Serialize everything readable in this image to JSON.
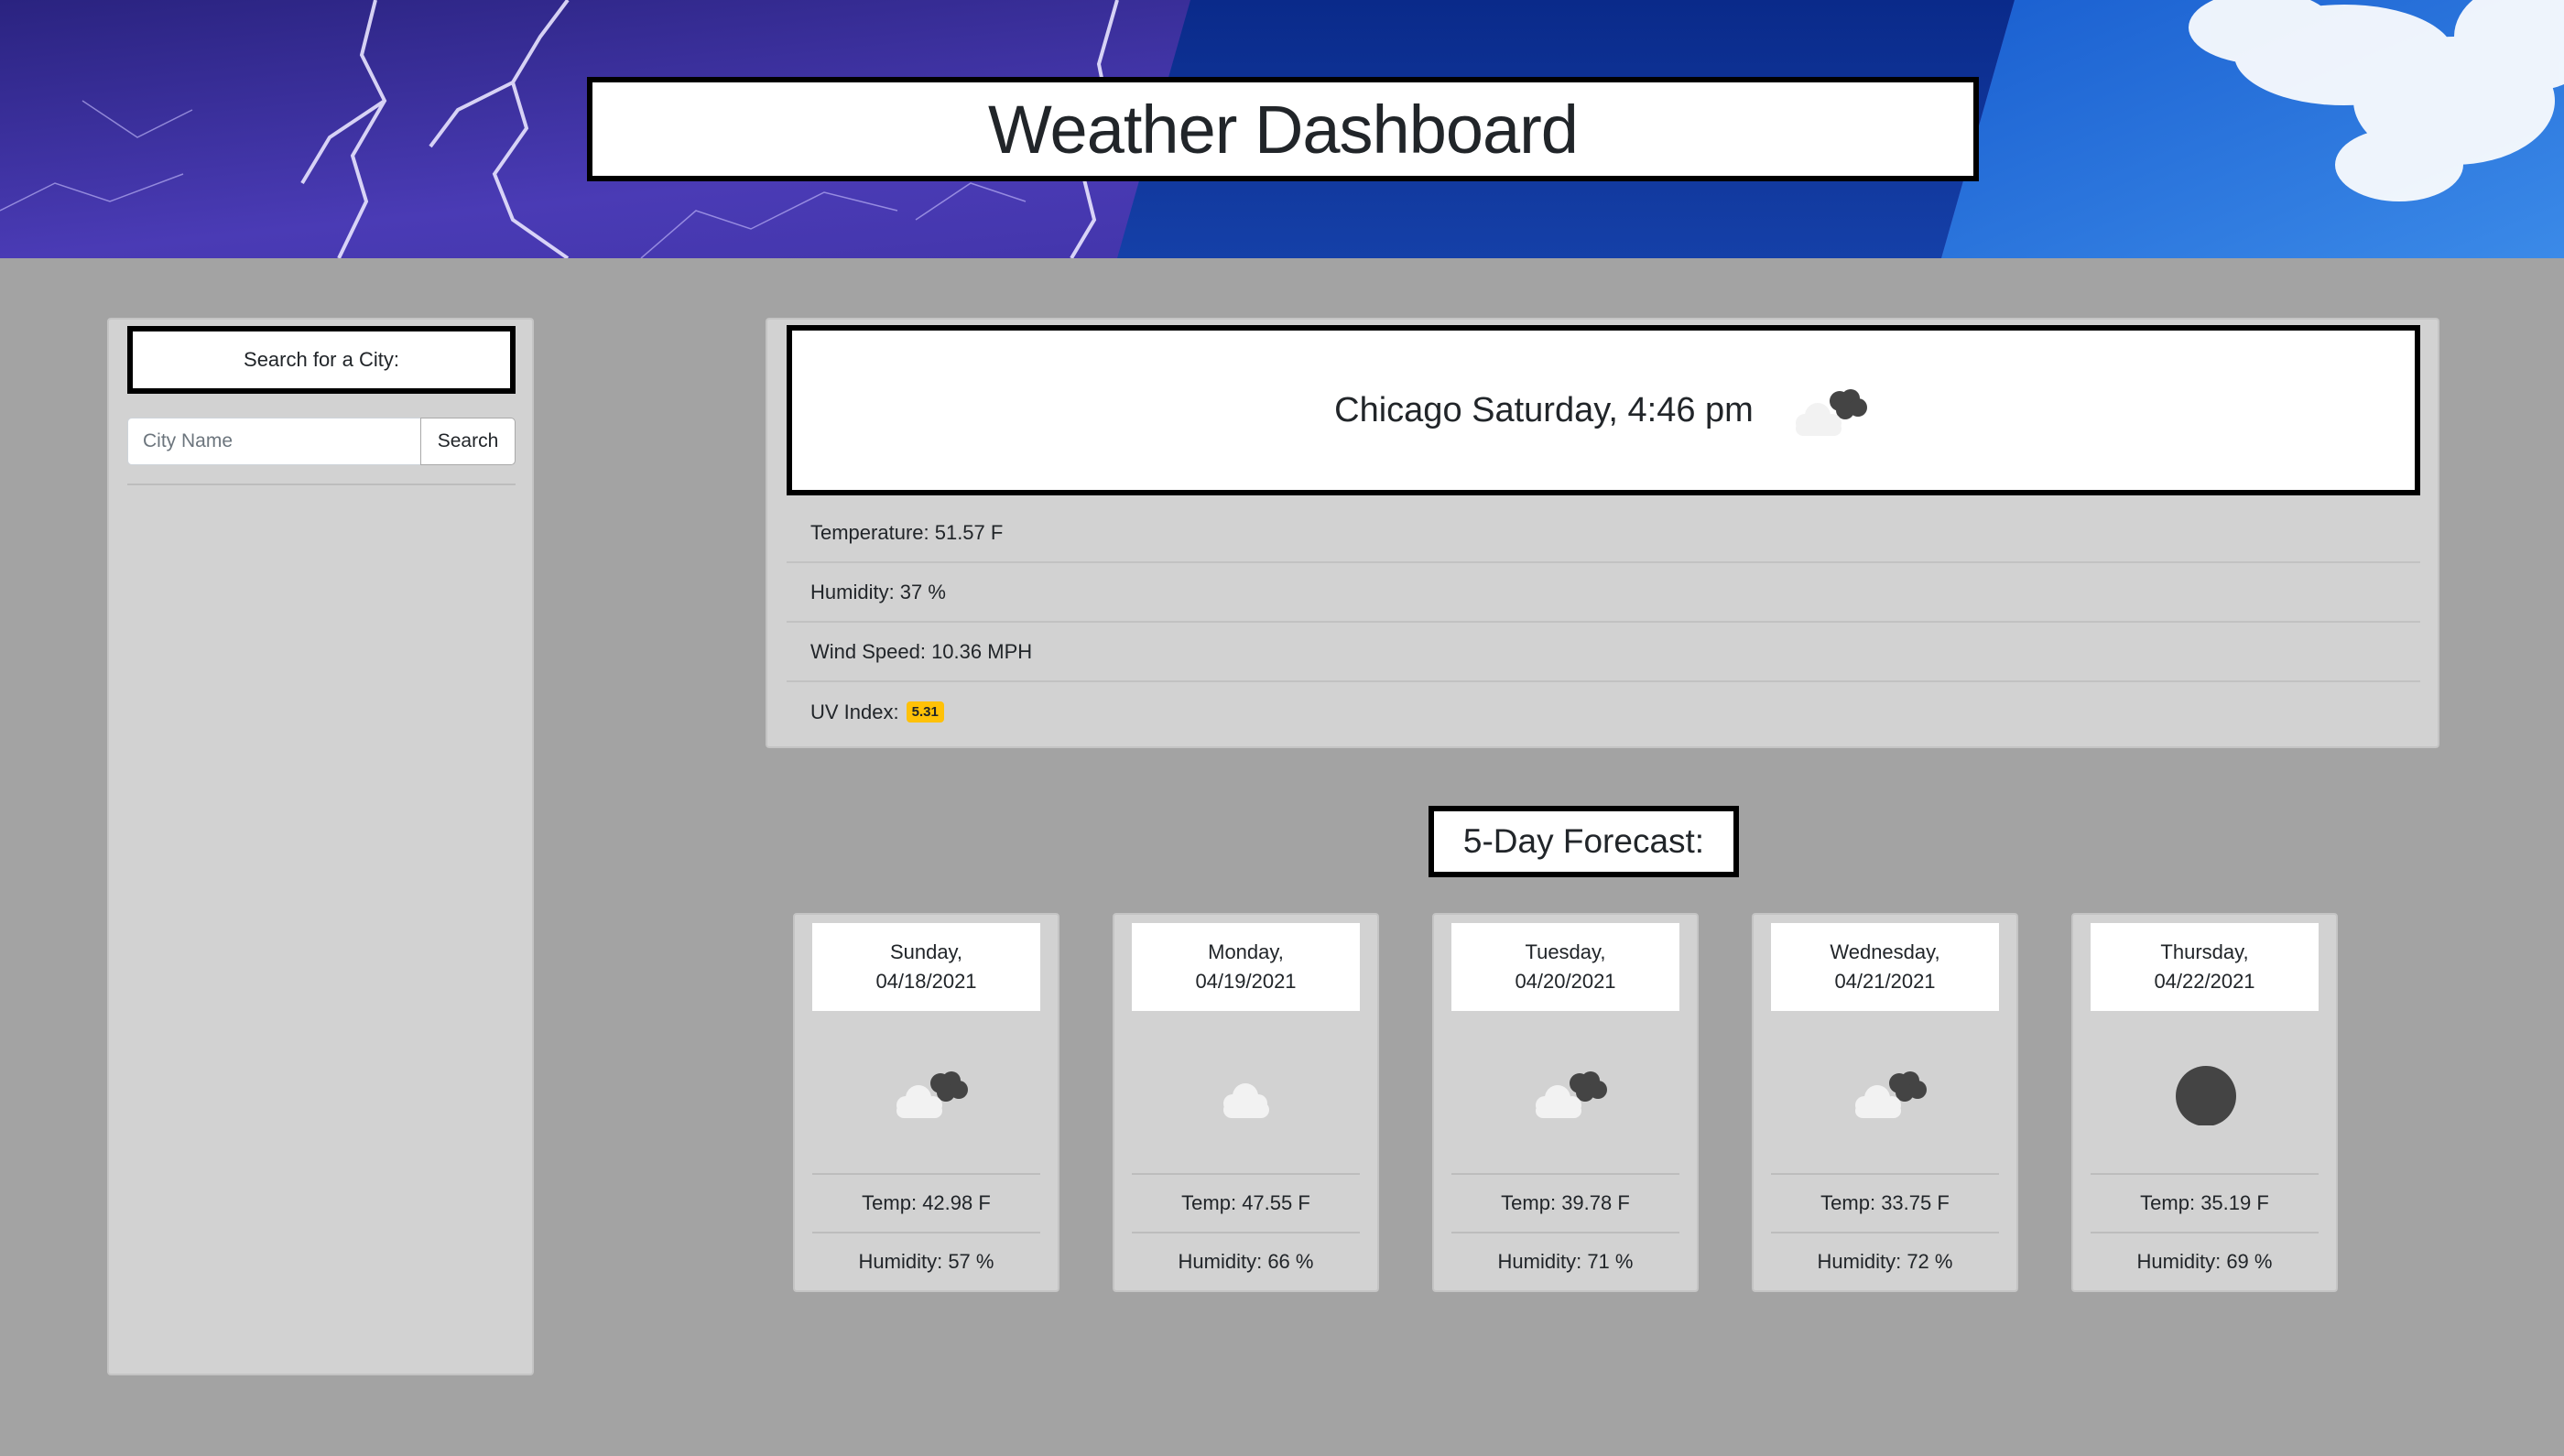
{
  "header": {
    "title": "Weather Dashboard"
  },
  "search": {
    "heading": "Search for a City:",
    "placeholder": "City Name",
    "button_label": "Search"
  },
  "current": {
    "city_date": "Chicago Saturday, 4:46 pm",
    "icon": "broken-clouds-icon",
    "temperature": "Temperature: 51.57 F",
    "humidity": "Humidity: 37 %",
    "wind": "Wind Speed: 10.36 MPH",
    "uv_label": "UV Index:",
    "uv_value": "5.31",
    "uv_color": "#ffc107"
  },
  "forecast": {
    "heading": "5-Day Forecast:",
    "days": [
      {
        "day": "Sunday,",
        "date": "04/18/2021",
        "icon": "broken-clouds-icon",
        "temp": "Temp: 42.98 F",
        "humidity": "Humidity: 57 %"
      },
      {
        "day": "Monday,",
        "date": "04/19/2021",
        "icon": "cloud-icon",
        "temp": "Temp: 47.55 F",
        "humidity": "Humidity: 66 %"
      },
      {
        "day": "Tuesday,",
        "date": "04/20/2021",
        "icon": "broken-clouds-icon",
        "temp": "Temp: 39.78 F",
        "humidity": "Humidity: 71 %"
      },
      {
        "day": "Wednesday,",
        "date": "04/21/2021",
        "icon": "broken-clouds-icon",
        "temp": "Temp: 33.75 F",
        "humidity": "Humidity: 72 %"
      },
      {
        "day": "Thursday,",
        "date": "04/22/2021",
        "icon": "dark-circle-icon",
        "temp": "Temp: 35.19 F",
        "humidity": "Humidity: 69 %"
      }
    ]
  },
  "colors": {
    "page_background": "#a3a3a3",
    "panel_background": "#d2d2d2",
    "storm_purple": "#3a2f9e",
    "sky_blue": "#1e63c9"
  }
}
